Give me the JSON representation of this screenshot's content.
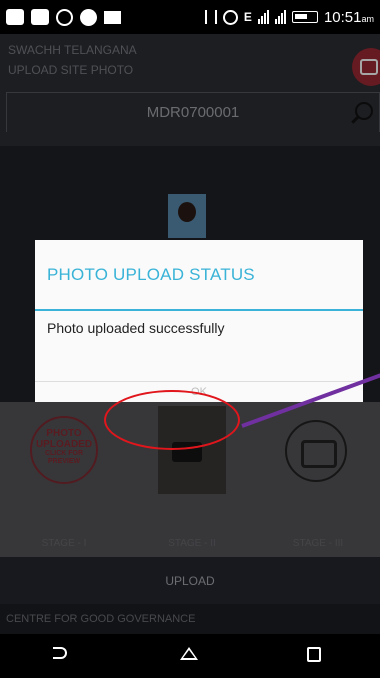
{
  "status_bar": {
    "time": "10:51",
    "ampm": "am",
    "network_label": "E"
  },
  "app": {
    "title": "SWACHH TELANGANA",
    "subtitle": "UPLOAD SITE PHOTO",
    "search_value": "MDR0700001",
    "stages": {
      "circle_line1": "PHOTO",
      "circle_line2": "UPLOADED",
      "circle_line3": "CLICK FOR",
      "circle_line4": "PREVIEW",
      "label_1": "STAGE - I",
      "label_2": "STAGE - II",
      "label_3": "STAGE - III"
    },
    "upload_label": "UPLOAD",
    "footer": "CENTRE FOR GOOD GOVERNANCE"
  },
  "dialog": {
    "title": "PHOTO UPLOAD STATUS",
    "message": "Photo uploaded successfully",
    "ok_label": "OK"
  },
  "colors": {
    "accent": "#39b3d7",
    "annotation": "#e0161c",
    "arrow": "#7030a0"
  }
}
